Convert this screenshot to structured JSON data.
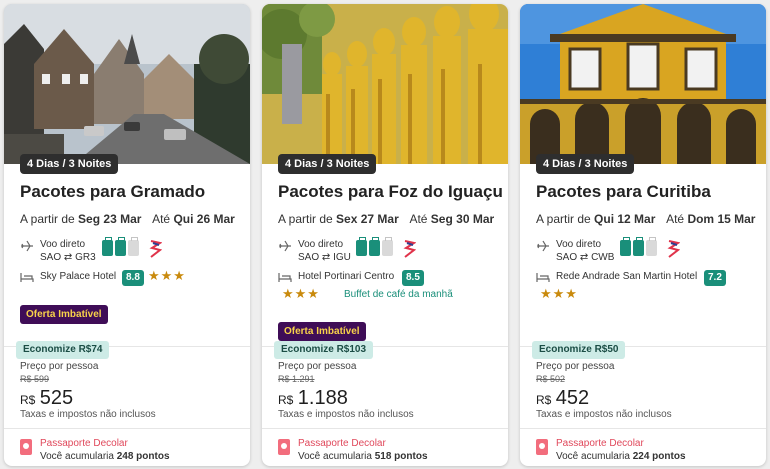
{
  "cards": [
    {
      "duration": "4 Dias / 3 Noites",
      "title": "Pacotes para Gramado",
      "from_label": "A partir de",
      "from_date": "Seg 23 Mar",
      "until_label": "Até",
      "until_date": "Qui 26 Mar",
      "flight_type": "Voo direto",
      "origin": "SAO",
      "destination": "GR3",
      "hotel_name": "Sky Palace Hotel",
      "hotel_score": "8.8",
      "stars": "★★★",
      "star_count": 3,
      "promo": "Oferta Imbatível",
      "saving": "Economize R$74",
      "price_label": "Preço por pessoa",
      "old_price": "R$ 599",
      "currency": "R$",
      "price": "525",
      "taxes": "Taxas e impostos não inclusos",
      "passport_title": "Passaporte Decolar",
      "passport_text": "Você acumularia",
      "points": "248 pontos"
    },
    {
      "duration": "4 Dias / 3 Noites",
      "title": "Pacotes para Foz do Iguaçu",
      "from_label": "A partir de",
      "from_date": "Sex 27 Mar",
      "until_label": "Até",
      "until_date": "Seg 30 Mar",
      "flight_type": "Voo direto",
      "origin": "SAO",
      "destination": "IGU",
      "hotel_name": "Hotel Portinari Centro",
      "hotel_score": "8.5",
      "stars": "★★★",
      "star_count": 3,
      "meal": "Buffet de café da manhã",
      "promo": "Oferta Imbatível",
      "saving": "Economize R$103",
      "price_label": "Preço por pessoa",
      "old_price": "R$ 1.291",
      "currency": "R$",
      "price": "1.188",
      "taxes": "Taxas e impostos não inclusos",
      "passport_title": "Passaporte Decolar",
      "passport_text": "Você acumularia",
      "points": "518 pontos"
    },
    {
      "duration": "4 Dias / 3 Noites",
      "title": "Pacotes para Curitiba",
      "from_label": "A partir de",
      "from_date": "Qui 12 Mar",
      "until_label": "Até",
      "until_date": "Dom 15 Mar",
      "flight_type": "Voo direto",
      "origin": "SAO",
      "destination": "CWB",
      "hotel_name": "Rede Andrade San Martin Hotel",
      "hotel_score": "7.2",
      "stars": "★★★",
      "star_count": 3,
      "saving": "Economize R$50",
      "price_label": "Preço por pessoa",
      "old_price": "R$ 502",
      "currency": "R$",
      "price": "452",
      "taxes": "Taxas e impostos não inclusos",
      "passport_title": "Passaporte Decolar",
      "passport_text": "Você acumularia",
      "points": "224 pontos"
    }
  ],
  "icons": {
    "flight": "plane-icon",
    "route": "round-trip-arrows-icon",
    "baggage": "luggage-icon",
    "airline": "airline-logo-icon",
    "hotel": "bed-icon",
    "passport": "passport-icon"
  },
  "colors": {
    "accent": "#1a8f7a",
    "promo_bg": "#3f0d57",
    "promo_text": "#f8d24a",
    "stars": "#c98a0d",
    "saving_bg": "#cdebe6",
    "passport": "#e0485b"
  }
}
